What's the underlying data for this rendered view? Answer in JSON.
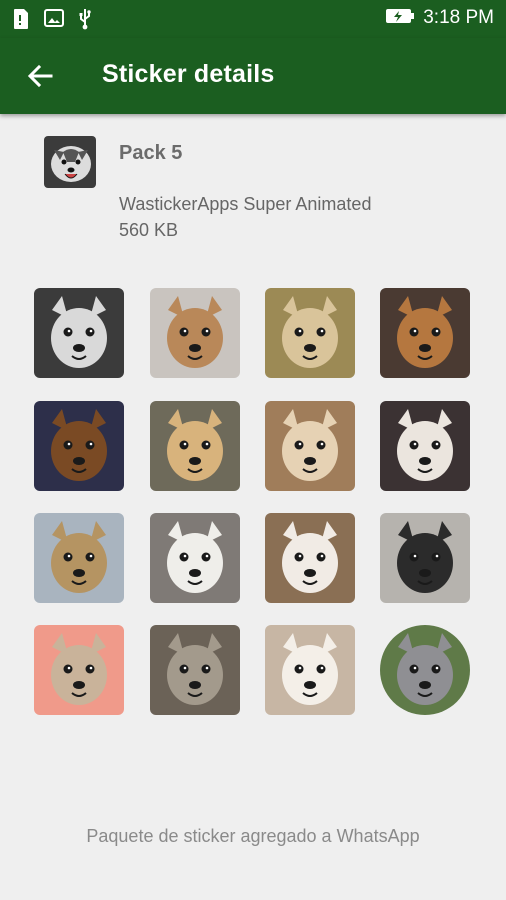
{
  "status_bar": {
    "time": "3:18 PM"
  },
  "app_bar": {
    "title": "Sticker details",
    "back_icon": "arrow-back-icon"
  },
  "pack": {
    "name": "Pack 5",
    "publisher": "WastickerApps Super Animated",
    "size": "560 KB"
  },
  "stickers": [
    {
      "name": "husky",
      "bg": "#3b3b3b",
      "fur": "#d9d9d9"
    },
    {
      "name": "chihuahua-tan",
      "bg": "#c9c4bf",
      "fur": "#b98859"
    },
    {
      "name": "chihuahua-smirk",
      "bg": "#9c8a55",
      "fur": "#d9c49a"
    },
    {
      "name": "chihuahua-big-eyes",
      "bg": "#4a3a32",
      "fur": "#b5773f"
    },
    {
      "name": "black-tan-dog",
      "bg": "#2d2f4a",
      "fur": "#7a4a24"
    },
    {
      "name": "chihuahua-window",
      "bg": "#6e6a5a",
      "fur": "#d8b37c"
    },
    {
      "name": "chihuahua-cream",
      "bg": "#a07d5a",
      "fur": "#e6d2b4"
    },
    {
      "name": "chihuahua-pink-collar",
      "bg": "#3b3233",
      "fur": "#ebe5de"
    },
    {
      "name": "pug-lake",
      "bg": "#a9b4bf",
      "fur": "#b59462"
    },
    {
      "name": "white-dog-eyebrows",
      "bg": "#7f7a76",
      "fur": "#efeeea"
    },
    {
      "name": "corgi-closeup",
      "bg": "#8a6f54",
      "fur": "#f1ebe5"
    },
    {
      "name": "french-bulldog",
      "bg": "#b6b3ae",
      "fur": "#2b2b2b"
    },
    {
      "name": "pug-pink",
      "bg": "#f09a8a",
      "fur": "#c9b39a"
    },
    {
      "name": "shih-tzu",
      "bg": "#6b6257",
      "fur": "#a39a8c"
    },
    {
      "name": "white-fluffy",
      "bg": "#c7b6a4",
      "fur": "#f4efe8"
    },
    {
      "name": "grey-dog-round",
      "bg": "#5f7a48",
      "fur": "#8f8f93"
    }
  ],
  "footer": {
    "message": "Paquete de sticker agregado a WhatsApp"
  },
  "colors": {
    "primary": "#1b5e20",
    "background": "#efefef"
  }
}
